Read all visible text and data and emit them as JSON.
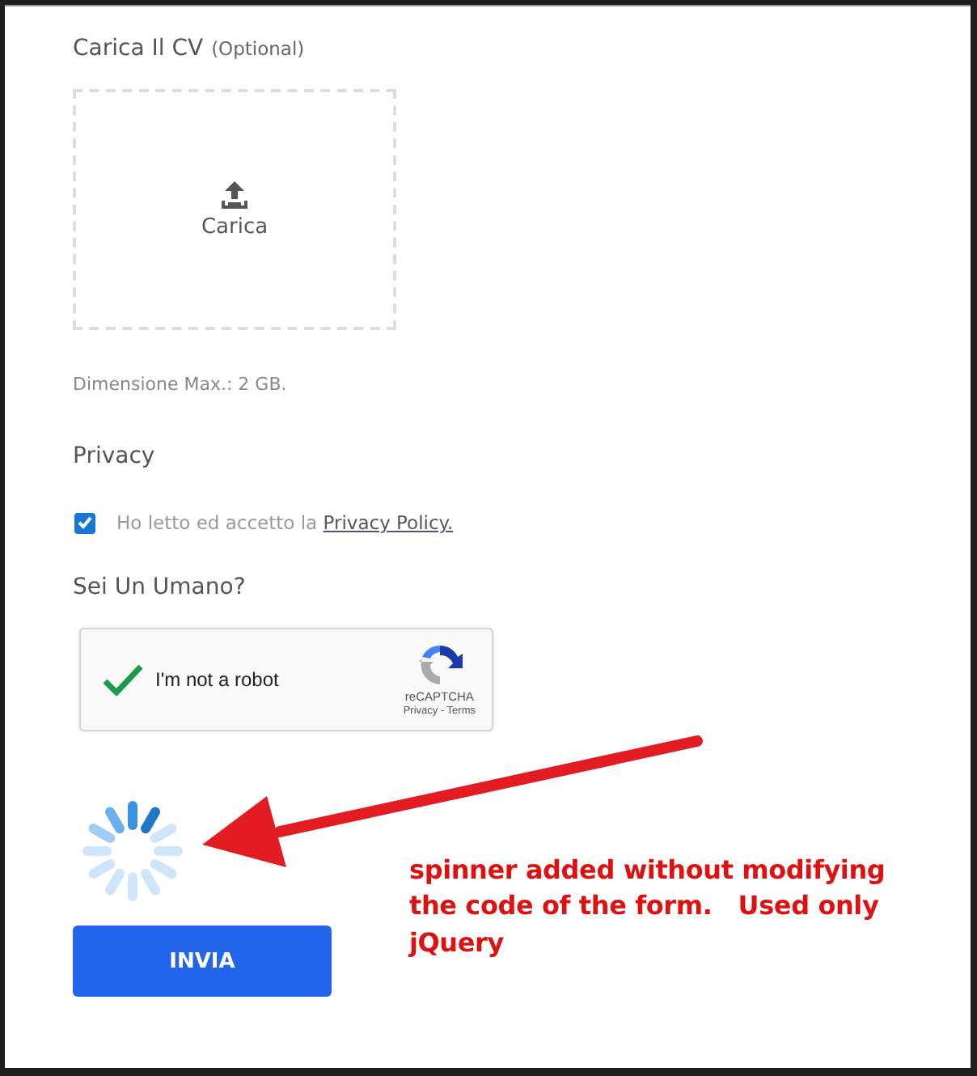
{
  "upload": {
    "label": "Carica Il CV",
    "optional": "(Optional)",
    "button": "Carica",
    "hint": "Dimensione Max.: 2 GB."
  },
  "privacy": {
    "heading": "Privacy",
    "checked": true,
    "text": "Ho letto ed accetto la ",
    "link": "Privacy Policy."
  },
  "captcha": {
    "heading": "Sei Un Umano?",
    "checked": true,
    "label": "I'm not a robot",
    "brand": "reCAPTCHA",
    "links": "Privacy - Terms"
  },
  "loading": true,
  "submit": {
    "label": "INVIA"
  },
  "annotation": {
    "text": "spinner added without modifying\nthe code of the form.   Used only\njQuery"
  }
}
